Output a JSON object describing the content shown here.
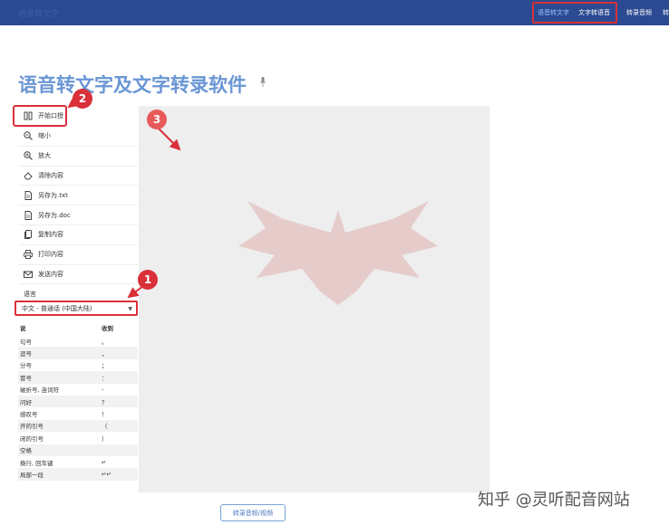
{
  "header": {
    "brand": "语音转文字",
    "nav": [
      {
        "label": "语音转文字",
        "active": true
      },
      {
        "label": "文字转语音",
        "active": false
      },
      {
        "label": "转录音频",
        "active": false
      },
      {
        "label": "转",
        "active": false
      }
    ]
  },
  "page_title": "语音转文字及文字转录软件",
  "sidebar": {
    "items": [
      {
        "label": "开始口授",
        "icon": "pause-icon"
      },
      {
        "label": "缩小",
        "icon": "zoom-out-icon"
      },
      {
        "label": "放大",
        "icon": "zoom-in-icon"
      },
      {
        "label": "清除内容",
        "icon": "eraser-icon"
      },
      {
        "label": "另存为.txt",
        "icon": "file-txt-icon"
      },
      {
        "label": "另存为.doc",
        "icon": "file-doc-icon"
      },
      {
        "label": "复制内容",
        "icon": "copy-icon"
      },
      {
        "label": "打印内容",
        "icon": "print-icon"
      },
      {
        "label": "发送内容",
        "icon": "mail-icon"
      }
    ]
  },
  "language": {
    "label": "语言",
    "selected": "中文 - 普通话 (中国大陆)"
  },
  "punctuation": {
    "headers": [
      "说",
      "收到"
    ],
    "rows": [
      [
        "句号",
        "。"
      ],
      [
        "逗号",
        "，"
      ],
      [
        "分号",
        "；"
      ],
      [
        "冒号",
        "："
      ],
      [
        "破折号, 连词符",
        "-"
      ],
      [
        "问好",
        "？"
      ],
      [
        "感叹号",
        "！"
      ],
      [
        "开的引号",
        "（"
      ],
      [
        "闭的引号",
        "）"
      ],
      [
        "空格",
        ""
      ],
      [
        "换行, 回车键",
        "↵"
      ],
      [
        "局部一段",
        "↵↵"
      ]
    ]
  },
  "annotations": [
    "1",
    "2",
    "3"
  ],
  "transcribe_button": "转录音频/视频",
  "site_watermark": "知乎 @灵听配音网站",
  "colors": {
    "header_bg": "#2b4a92",
    "title": "#6a96d4",
    "highlight": "#d9303a",
    "editor_bg": "#eeeeee"
  }
}
